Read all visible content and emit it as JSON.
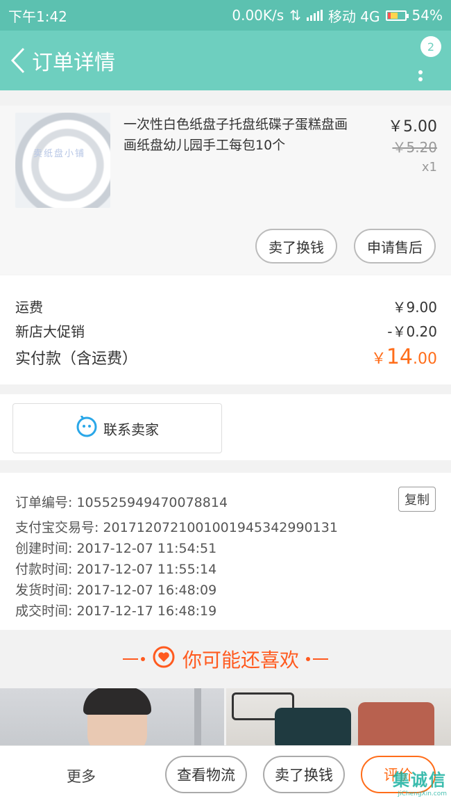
{
  "status_bar": {
    "time": "下午1:42",
    "network_speed": "0.00K/s",
    "carrier": "移动 4G",
    "battery": "54%"
  },
  "header": {
    "title": "订单详情",
    "badge_count": "2"
  },
  "product": {
    "image_watermark": "卖纸盘小铺",
    "name": "一次性白色纸盘子托盘纸碟子蛋糕盘画画纸盘幼儿园手工每包10个",
    "price": "￥5.00",
    "original_price": "￥5.20",
    "quantity": "x1",
    "actions": {
      "resell_label": "卖了换钱",
      "after_sale_label": "申请售后"
    }
  },
  "fees": {
    "shipping_label": "运费",
    "shipping_value": "￥9.00",
    "promo_label": "新店大促销",
    "promo_value": "-￥0.20",
    "total_label": "实付款（含运费）",
    "total_currency": "￥",
    "total_integer": "14",
    "total_decimal": ".00"
  },
  "contact": {
    "label": "联系卖家"
  },
  "order_info": {
    "order_no": "订单编号: 105525949470078814",
    "copy_label": "复制",
    "alipay_no": "支付宝交易号: 2017120721001001945342990131",
    "created": "创建时间: 2017-12-07 11:54:51",
    "paid": "付款时间: 2017-12-07 11:55:14",
    "shipped": "发货时间: 2017-12-07 16:48:09",
    "completed": "成交时间: 2017-12-17 16:48:19"
  },
  "recommend": {
    "title": "你可能还喜欢"
  },
  "bottom_bar": {
    "more_label": "更多",
    "logistics_label": "查看物流",
    "resell_label": "卖了换钱",
    "review_label": "评价"
  },
  "watermark": {
    "logo": "集诚信",
    "url": "JiChengXin.com"
  },
  "colors": {
    "header_bg": "#6ecfbf",
    "status_bg": "#5cc1b0",
    "accent_orange": "#ff6d1a"
  }
}
